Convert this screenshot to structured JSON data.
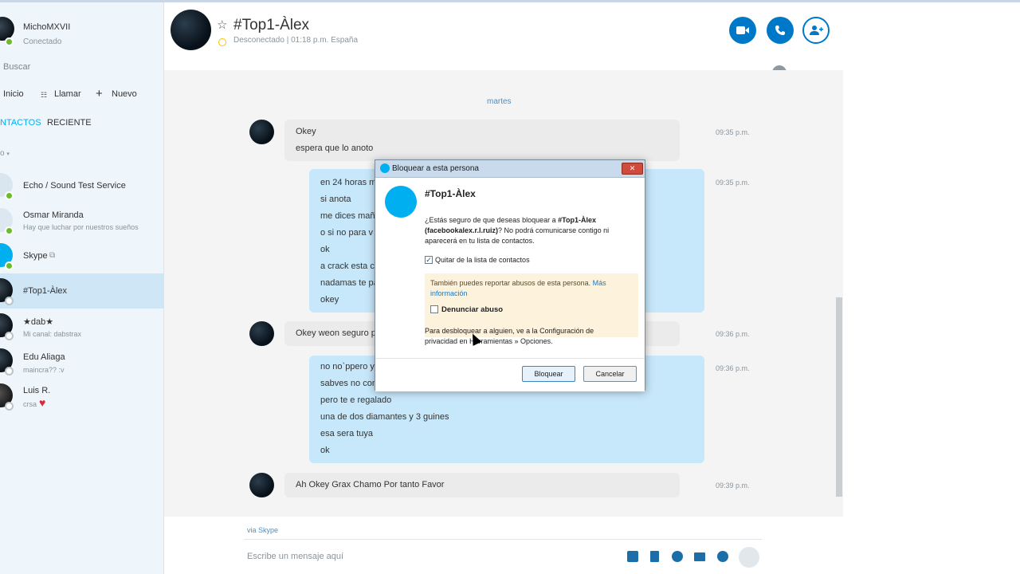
{
  "user": {
    "name": "MichoMXVII",
    "status": "Conectado"
  },
  "sidebar": {
    "search_placeholder": "Buscar",
    "toolbar": {
      "home": "Inicio",
      "call": "Llamar",
      "new": "Nuevo"
    },
    "tabs": {
      "contacts": "NTACTOS",
      "recent": "RECIENTE"
    },
    "group_label": "o",
    "contacts": [
      {
        "name": "Echo / Sound Test Service",
        "sub": ""
      },
      {
        "name": "Osmar Miranda",
        "sub": "Hay que luchar por nuestros sueños"
      },
      {
        "name": "Skype",
        "sub": ""
      },
      {
        "name": "#Top1-Àlex",
        "sub": ""
      },
      {
        "name": "★dab★",
        "sub": "Mi canal: dabstrax"
      },
      {
        "name": "Edu Aliaga",
        "sub": "maincra?? :v"
      },
      {
        "name": "Luis R.",
        "sub": "crsa"
      }
    ]
  },
  "chat": {
    "title": "#Top1-Àlex",
    "status": "Desconectado  |  01:18 p.m. España",
    "day": "martes",
    "messages": [
      {
        "lines": [
          "Okey",
          "espera que lo anoto"
        ],
        "time": "09:35 p.m."
      },
      {
        "lines": [
          "en 24 horas m",
          "si anota",
          "me dices mañ",
          "o si no para v",
          "ok",
          "a crack esta cu",
          "nadamas te pa",
          "okey"
        ],
        "time": "09:35 p.m."
      },
      {
        "lines": [
          "Okey weon seguro p"
        ],
        "time": "09:36 p.m."
      },
      {
        "lines": [
          "no no`ppero y",
          "sabves no con",
          "pero te e regalado",
          "una de dos diamantes y 3 guines",
          "esa sera tuya",
          "ok"
        ],
        "time": "09:36 p.m."
      },
      {
        "lines": [
          "Ah Okey Grax Chamo Por tanto Favor"
        ],
        "time": "09:39 p.m."
      }
    ],
    "via": "via",
    "via_link": "Skype",
    "compose_placeholder": "Escribe un mensaje aquí"
  },
  "dialog": {
    "title": "Bloquear a esta persona",
    "name": "#Top1-Àlex",
    "question_1": "¿Estás seguro de que deseas bloquear a ",
    "question_name": "#Top1-Àlex",
    "question_id": "(facebookalex.r.l.ruiz)",
    "question_2": "? No podrá comunicarse contigo ni aparecerá en tu lista de contactos.",
    "remove_label": "Quitar de la lista de contactos",
    "report_text": "También puedes reportar abusos de esta persona.",
    "report_link": "Más información",
    "report_label": "Denunciar abuso",
    "unblock_text": "Para desbloquear a alguien, ve a la Configuración de privacidad en Herramientas » Opciones.",
    "block_button": "Bloquear",
    "cancel_button": "Cancelar",
    "remove_checked": true,
    "report_checked": false
  },
  "colors": {
    "accent": "#00aff0",
    "button_blue": "#0078c8",
    "outgoing_bubble": "#c7e8fa",
    "incoming_bubble": "#ebebeb"
  }
}
